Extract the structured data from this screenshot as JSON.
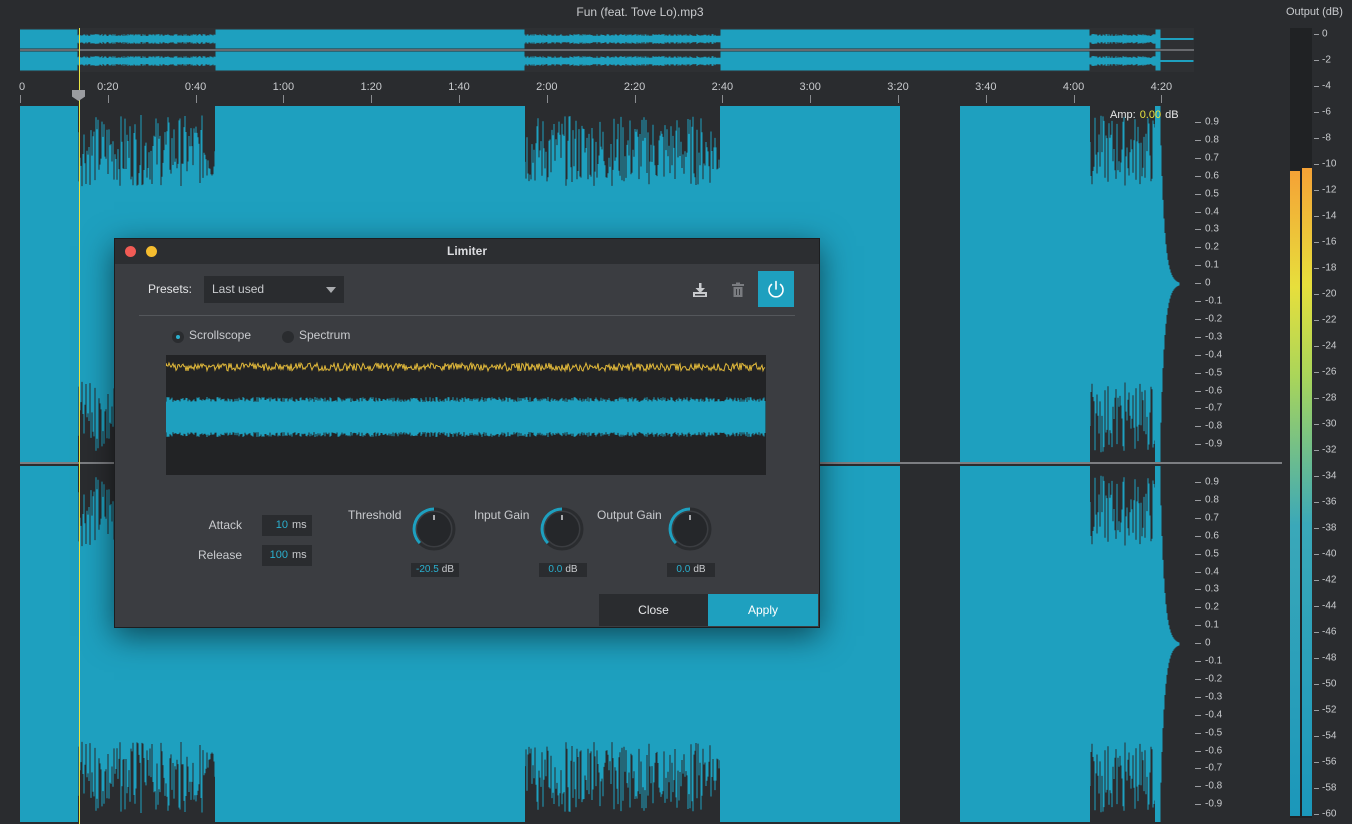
{
  "window": {
    "title": "Fun (feat. Tove Lo).mp3"
  },
  "timeline": {
    "labels": [
      "0",
      "0:20",
      "0:40",
      "1:00",
      "1:20",
      "1:40",
      "2:00",
      "2:20",
      "2:40",
      "3:00",
      "3:20",
      "3:40",
      "4:00",
      "4:20"
    ],
    "seconds": [
      0,
      20,
      40,
      60,
      80,
      100,
      120,
      140,
      160,
      180,
      200,
      220,
      240,
      260
    ]
  },
  "amplitude": {
    "label": "Amp:",
    "value": "0.00",
    "unit": "dB",
    "scale_labels": [
      "0.9",
      "0.8",
      "0.7",
      "0.6",
      "0.5",
      "0.4",
      "0.3",
      "0.2",
      "0.1",
      "0",
      "-0.1",
      "-0.2",
      "-0.3",
      "-0.4",
      "-0.5",
      "-0.6",
      "-0.7",
      "-0.8",
      "-0.9"
    ]
  },
  "output_meter": {
    "title": "Output (dB)",
    "labels": [
      "0",
      "-2",
      "-4",
      "-6",
      "-8",
      "-10",
      "-12",
      "-14",
      "-16",
      "-18",
      "-20",
      "-22",
      "-24",
      "-26",
      "-28",
      "-30",
      "-32",
      "-34",
      "-36",
      "-38",
      "-40",
      "-42",
      "-44",
      "-46",
      "-48",
      "-50",
      "-52",
      "-54",
      "-56",
      "-58",
      "-60"
    ],
    "left_level_db": -10.5,
    "right_level_db": -10.3
  },
  "limiter": {
    "title": "Limiter",
    "presets_label": "Presets:",
    "preset_value": "Last used",
    "view_options": [
      "Scrollscope",
      "Spectrum"
    ],
    "selected_view": "Scrollscope",
    "attack": {
      "label": "Attack",
      "value": "10",
      "unit": "ms"
    },
    "release": {
      "label": "Release",
      "value": "100",
      "unit": "ms"
    },
    "threshold": {
      "label": "Threshold",
      "value": "-20.5",
      "unit": "dB"
    },
    "input_gain": {
      "label": "Input Gain",
      "value": "0.0",
      "unit": "dB"
    },
    "output_gain": {
      "label": "Output Gain",
      "value": "0.0",
      "unit": "dB"
    },
    "close_label": "Close",
    "apply_label": "Apply"
  },
  "colors": {
    "waveform": "#1ea0bf",
    "accent": "#2bb0cf",
    "cursor": "#e9e545",
    "scope_line": "#e0b83a"
  }
}
